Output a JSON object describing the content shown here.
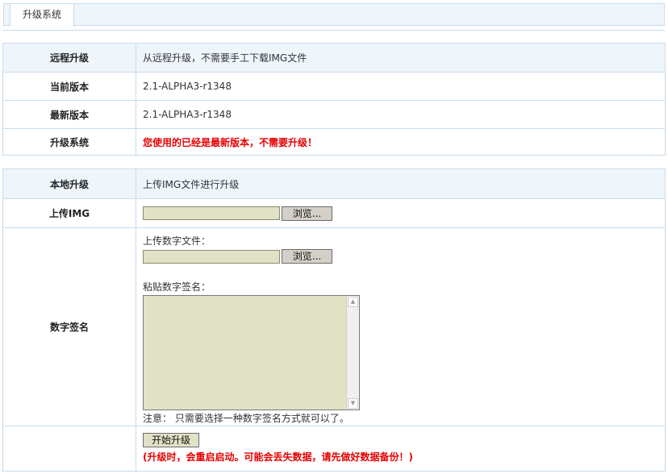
{
  "tabs": {
    "active": "升级系统"
  },
  "remote": {
    "label": "远程升级",
    "desc": "从远程升级，不需要手工下载IMG文件",
    "current_label": "当前版本",
    "current_value": "2.1-ALPHA3-r1348",
    "latest_label": "最新版本",
    "latest_value": "2.1-ALPHA3-r1348",
    "upgrade_label": "升级系统",
    "upgrade_msg": "您使用的已经是最新版本，不需要升级！"
  },
  "local": {
    "label": "本地升级",
    "desc": "上传IMG文件进行升级",
    "upload_label": "上传IMG",
    "browse": "浏览...",
    "sig_label": "数字签名",
    "sig_file_label": "上传数字文件：",
    "sig_paste_label": "粘贴数字签名：",
    "sig_note": "注意：  只需要选择一种数字签名方式就可以了。",
    "start_button": "开始升级",
    "warning": "(升级时，会重启启动。可能会丢失数据，请先做好数据备份！)"
  }
}
